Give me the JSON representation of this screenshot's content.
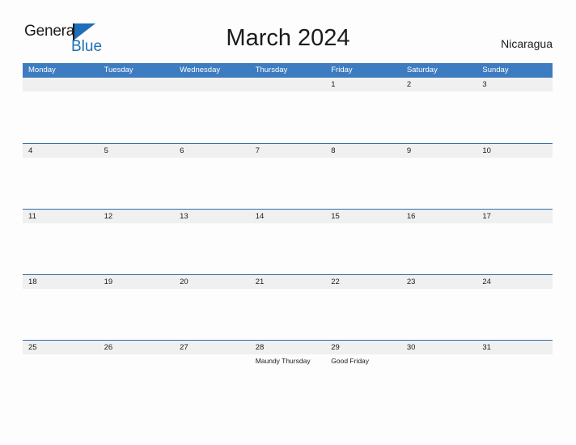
{
  "brand": {
    "name_part1": "General",
    "name_part2": "Blue",
    "flag_icon": "blue-flag-triangle",
    "accent_color": "#1f6fb8"
  },
  "header": {
    "title": "March 2024",
    "country": "Nicaragua"
  },
  "colors": {
    "weekday_header_bg": "#3d7cc0",
    "week_band_bg": "#f0f0f0",
    "week_border": "#2e6da4",
    "text": "#1b1b1b",
    "weekday_text": "#ffffff"
  },
  "calendar": {
    "month": "March",
    "year": "2024",
    "weekday_headers": [
      "Monday",
      "Tuesday",
      "Wednesday",
      "Thursday",
      "Friday",
      "Saturday",
      "Sunday"
    ],
    "weeks": [
      {
        "days": [
          {
            "date": "",
            "events": []
          },
          {
            "date": "",
            "events": []
          },
          {
            "date": "",
            "events": []
          },
          {
            "date": "",
            "events": []
          },
          {
            "date": "1",
            "events": []
          },
          {
            "date": "2",
            "events": []
          },
          {
            "date": "3",
            "events": []
          }
        ]
      },
      {
        "days": [
          {
            "date": "4",
            "events": []
          },
          {
            "date": "5",
            "events": []
          },
          {
            "date": "6",
            "events": []
          },
          {
            "date": "7",
            "events": []
          },
          {
            "date": "8",
            "events": []
          },
          {
            "date": "9",
            "events": []
          },
          {
            "date": "10",
            "events": []
          }
        ]
      },
      {
        "days": [
          {
            "date": "11",
            "events": []
          },
          {
            "date": "12",
            "events": []
          },
          {
            "date": "13",
            "events": []
          },
          {
            "date": "14",
            "events": []
          },
          {
            "date": "15",
            "events": []
          },
          {
            "date": "16",
            "events": []
          },
          {
            "date": "17",
            "events": []
          }
        ]
      },
      {
        "days": [
          {
            "date": "18",
            "events": []
          },
          {
            "date": "19",
            "events": []
          },
          {
            "date": "20",
            "events": []
          },
          {
            "date": "21",
            "events": []
          },
          {
            "date": "22",
            "events": []
          },
          {
            "date": "23",
            "events": []
          },
          {
            "date": "24",
            "events": []
          }
        ]
      },
      {
        "days": [
          {
            "date": "25",
            "events": []
          },
          {
            "date": "26",
            "events": []
          },
          {
            "date": "27",
            "events": []
          },
          {
            "date": "28",
            "events": [
              "Maundy Thursday"
            ]
          },
          {
            "date": "29",
            "events": [
              "Good Friday"
            ]
          },
          {
            "date": "30",
            "events": []
          },
          {
            "date": "31",
            "events": []
          }
        ]
      }
    ]
  }
}
